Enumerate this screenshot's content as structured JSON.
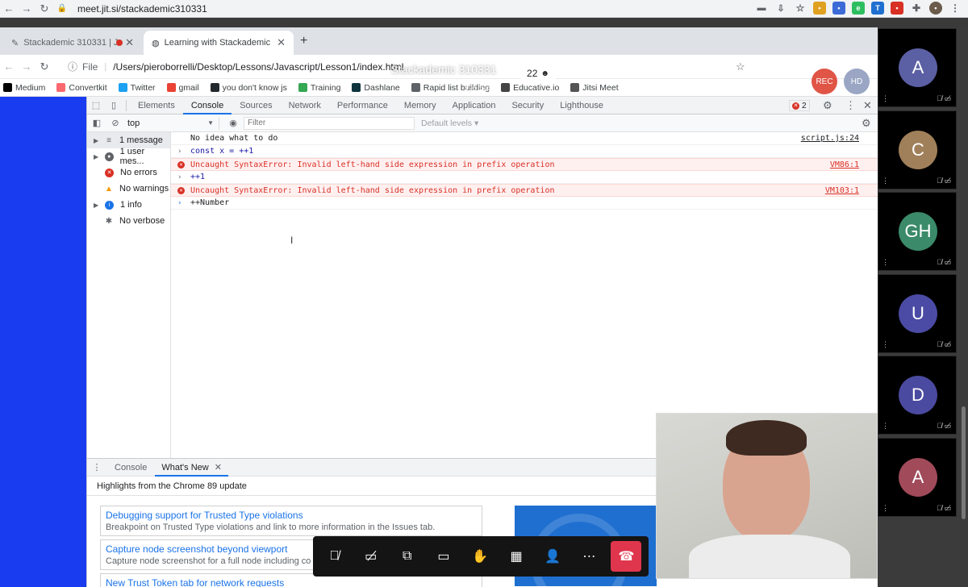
{
  "outer_browser": {
    "url": "meet.jit.si/stackademic310331"
  },
  "meeting": {
    "title": "Stackademic 310331",
    "participant_count": "22",
    "timer": "1:25:58",
    "rec_label": "REC",
    "hd_label": "HD",
    "participants": [
      {
        "initials": "A",
        "color": "#5b5fa3"
      },
      {
        "initials": "C",
        "color": "#a0805a"
      },
      {
        "initials": "GH",
        "color": "#3b8a6a"
      },
      {
        "initials": "U",
        "color": "#4b4ba5"
      },
      {
        "initials": "D",
        "color": "#4a4aa0"
      },
      {
        "initials": "A",
        "color": "#a04a5a"
      }
    ]
  },
  "shared_browser": {
    "tabs": [
      {
        "label": "Stackademic 310331 | Jitsi"
      },
      {
        "label": "Learning with Stackademic"
      }
    ],
    "address_prefix": "File",
    "address": "/Users/pieroborrelli/Desktop/Lessons/Javascript/Lesson1/index.html",
    "bookmarks": [
      {
        "label": "Medium",
        "color": "#000000"
      },
      {
        "label": "Convertkit",
        "color": "#fb6970"
      },
      {
        "label": "Twitter",
        "color": "#1da1f2"
      },
      {
        "label": "gmail",
        "color": "#ea4335"
      },
      {
        "label": "you don't know js",
        "color": "#24292e"
      },
      {
        "label": "Training",
        "color": "#34a853"
      },
      {
        "label": "Dashlane",
        "color": "#0e353d"
      },
      {
        "label": "Rapid list building",
        "color": "#5f6368"
      },
      {
        "label": "Educative.io",
        "color": "#444444"
      },
      {
        "label": "Jitsi Meet",
        "color": "#555555"
      }
    ]
  },
  "devtools": {
    "tabs": [
      "Elements",
      "Console",
      "Sources",
      "Network",
      "Performance",
      "Memory",
      "Application",
      "Security",
      "Lighthouse"
    ],
    "active_tab": "Console",
    "error_badge": "2",
    "context": "top",
    "filter_placeholder": "Filter",
    "levels": "Default levels",
    "sidebar": [
      {
        "label": "1 message",
        "icon": "list-icon"
      },
      {
        "label": "1 user mes...",
        "icon": "user-icon"
      },
      {
        "label": "No errors",
        "icon": "error-icon"
      },
      {
        "label": "No warnings",
        "icon": "warning-icon"
      },
      {
        "label": "1 info",
        "icon": "info-icon"
      },
      {
        "label": "No verbose",
        "icon": "bug-icon"
      }
    ],
    "console": [
      {
        "kind": "log",
        "text": "No idea what to do",
        "source": "script.js:24"
      },
      {
        "kind": "input",
        "text": "const x = ++1",
        "source": ""
      },
      {
        "kind": "error",
        "text": "Uncaught SyntaxError: Invalid left-hand side expression in prefix operation",
        "source": "VM86:1"
      },
      {
        "kind": "input",
        "text": "++1",
        "source": ""
      },
      {
        "kind": "error",
        "text": "Uncaught SyntaxError: Invalid left-hand side expression in prefix operation",
        "source": "VM103:1"
      },
      {
        "kind": "prompt",
        "text": "++Number",
        "source": ""
      }
    ],
    "drawer": {
      "tabs": [
        "Console",
        "What's New"
      ],
      "headline": "Highlights from the Chrome 89 update",
      "cards": [
        {
          "title": "Debugging support for Trusted Type violations",
          "desc": "Breakpoint on Trusted Type violations and link to more information in the Issues tab."
        },
        {
          "title": "Capture node screenshot beyond viewport",
          "desc": "Capture node screenshot for a full node including co"
        },
        {
          "title": "New Trust Token tab for network requests",
          "desc": ""
        }
      ]
    }
  }
}
